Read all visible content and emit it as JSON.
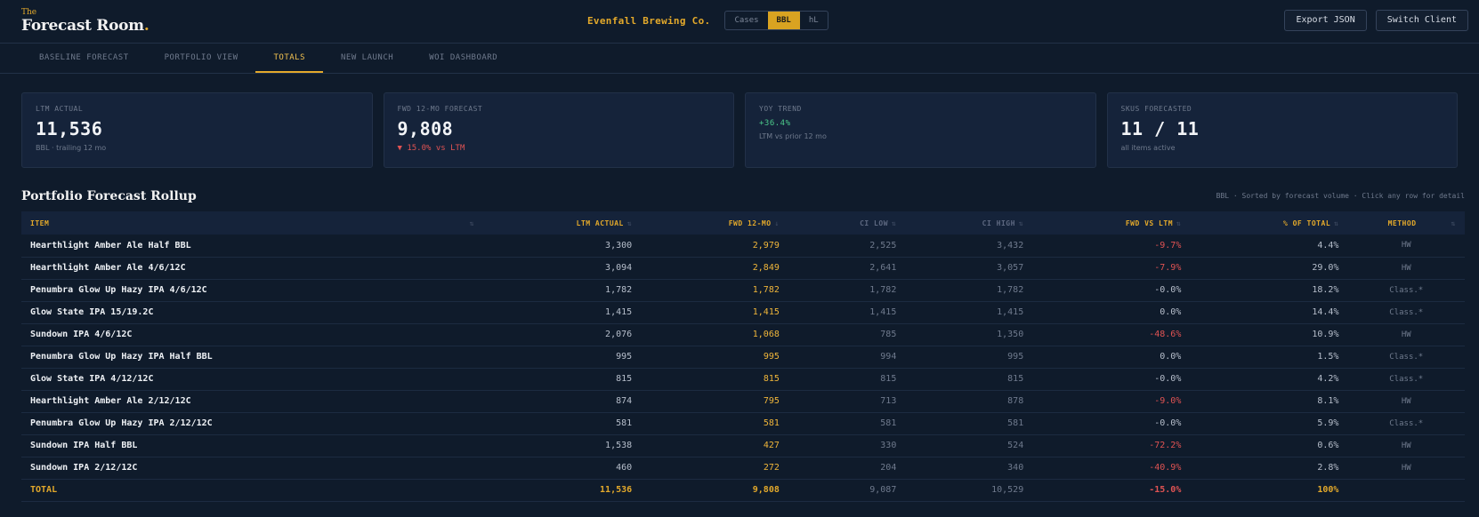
{
  "brand": {
    "the": "The",
    "name": "Forecast Room",
    "dot": "."
  },
  "client": {
    "name": "Evenfall Brewing Co."
  },
  "units": [
    "Cases",
    "BBL",
    "hL"
  ],
  "actions": {
    "export": "Export JSON",
    "switch": "Switch Client"
  },
  "tabs": [
    "BASELINE FORECAST",
    "PORTFOLIO VIEW",
    "TOTALS",
    "NEW LAUNCH",
    "WOI DASHBOARD"
  ],
  "kpis": [
    {
      "label": "LTM ACTUAL",
      "value": "11,536",
      "sub": "BBL · trailing 12 mo"
    },
    {
      "label": "FWD 12-MO FORECAST",
      "value": "9,808",
      "sub": "▼ 15.0% vs LTM"
    },
    {
      "label": "YOY TREND",
      "value": "+36.4%",
      "sub": "LTM vs prior 12 mo"
    },
    {
      "label": "SKUS FORECASTED",
      "value": "11 / 11",
      "sub": "all items active"
    }
  ],
  "section": {
    "title": "Portfolio Forecast Rollup",
    "note": "BBL · Sorted by forecast volume · Click any row for detail"
  },
  "table": {
    "headers": [
      "ITEM",
      "LTM ACTUAL",
      "FWD 12-MO",
      "CI LOW",
      "CI HIGH",
      "FWD VS LTM",
      "% OF TOTAL",
      "METHOD"
    ],
    "sort_marks": [
      "⇅",
      "⇅",
      "↓",
      "⇅",
      "⇅",
      "⇅",
      "⇅",
      "⇅"
    ],
    "rows": [
      [
        "Hearthlight Amber Ale Half BBL",
        "3,300",
        "2,979",
        "2,525",
        "3,432",
        "-9.7%",
        "4.4%",
        "HW"
      ],
      [
        "Hearthlight Amber Ale 4/6/12C",
        "3,094",
        "2,849",
        "2,641",
        "3,057",
        "-7.9%",
        "29.0%",
        "HW"
      ],
      [
        "Penumbra Glow Up Hazy IPA 4/6/12C",
        "1,782",
        "1,782",
        "1,782",
        "1,782",
        "-0.0%",
        "18.2%",
        "Class.*"
      ],
      [
        "Glow State IPA 15/19.2C",
        "1,415",
        "1,415",
        "1,415",
        "1,415",
        "0.0%",
        "14.4%",
        "Class.*"
      ],
      [
        "Sundown IPA 4/6/12C",
        "2,076",
        "1,068",
        "785",
        "1,350",
        "-48.6%",
        "10.9%",
        "HW"
      ],
      [
        "Penumbra Glow Up Hazy IPA Half BBL",
        "995",
        "995",
        "994",
        "995",
        "0.0%",
        "1.5%",
        "Class.*"
      ],
      [
        "Glow State IPA 4/12/12C",
        "815",
        "815",
        "815",
        "815",
        "-0.0%",
        "4.2%",
        "Class.*"
      ],
      [
        "Hearthlight Amber Ale 2/12/12C",
        "874",
        "795",
        "713",
        "878",
        "-9.0%",
        "8.1%",
        "HW"
      ],
      [
        "Penumbra Glow Up Hazy IPA 2/12/12C",
        "581",
        "581",
        "581",
        "581",
        "-0.0%",
        "5.9%",
        "Class.*"
      ],
      [
        "Sundown IPA Half BBL",
        "1,538",
        "427",
        "330",
        "524",
        "-72.2%",
        "0.6%",
        "HW"
      ],
      [
        "Sundown IPA 2/12/12C",
        "460",
        "272",
        "204",
        "340",
        "-40.9%",
        "2.8%",
        "HW"
      ]
    ],
    "total": [
      "TOTAL",
      "11,536",
      "9,808",
      "9,087",
      "10,529",
      "-15.0%",
      "100%",
      ""
    ]
  },
  "colors": {
    "accent": "#e3a92b",
    "negative": "#e05353",
    "positive": "#4cc98a",
    "background": "#0f1b2b"
  }
}
